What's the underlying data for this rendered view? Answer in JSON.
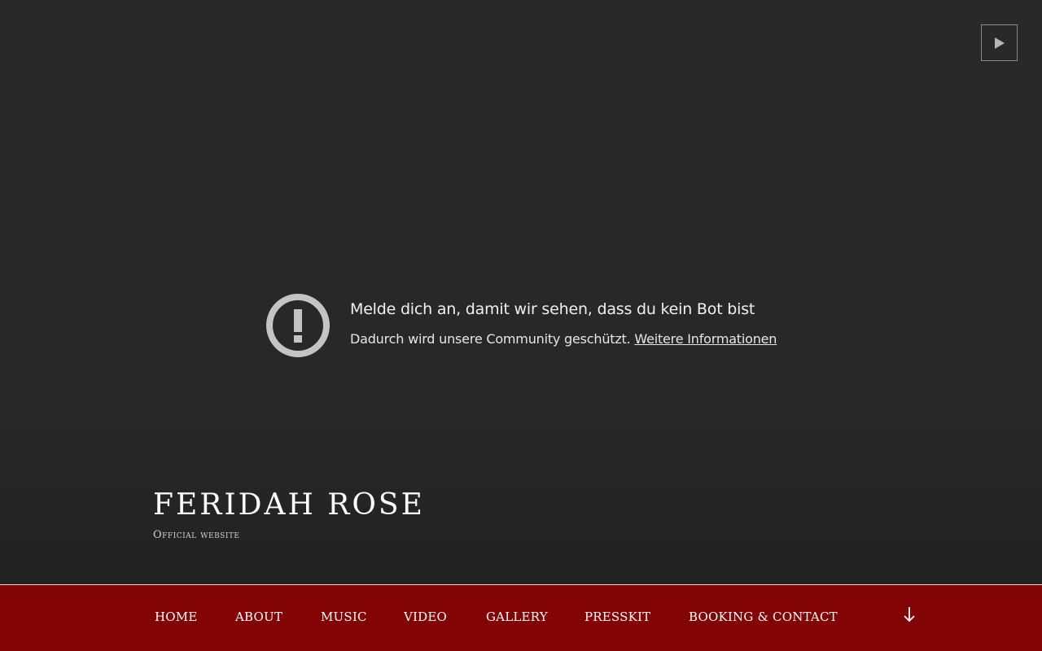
{
  "player": {
    "play_icon": "play-icon"
  },
  "notice": {
    "icon": "alert-circle-icon",
    "title": "Melde dich an, damit wir sehen, dass du kein Bot bist",
    "text": "Dadurch wird unsere Community geschützt.",
    "link": "Weitere Informationen"
  },
  "site": {
    "title": "FERIDAH ROSE",
    "subtitle": "Official website"
  },
  "nav": {
    "items": [
      "HOME",
      "ABOUT",
      "MUSIC",
      "VIDEO",
      "GALLERY",
      "PRESSKIT",
      "BOOKING & CONTACT"
    ],
    "scroll_icon": "arrow-down-icon"
  },
  "colors": {
    "background": "#282828",
    "nav_background": "#820404",
    "text": "#ffffff"
  }
}
